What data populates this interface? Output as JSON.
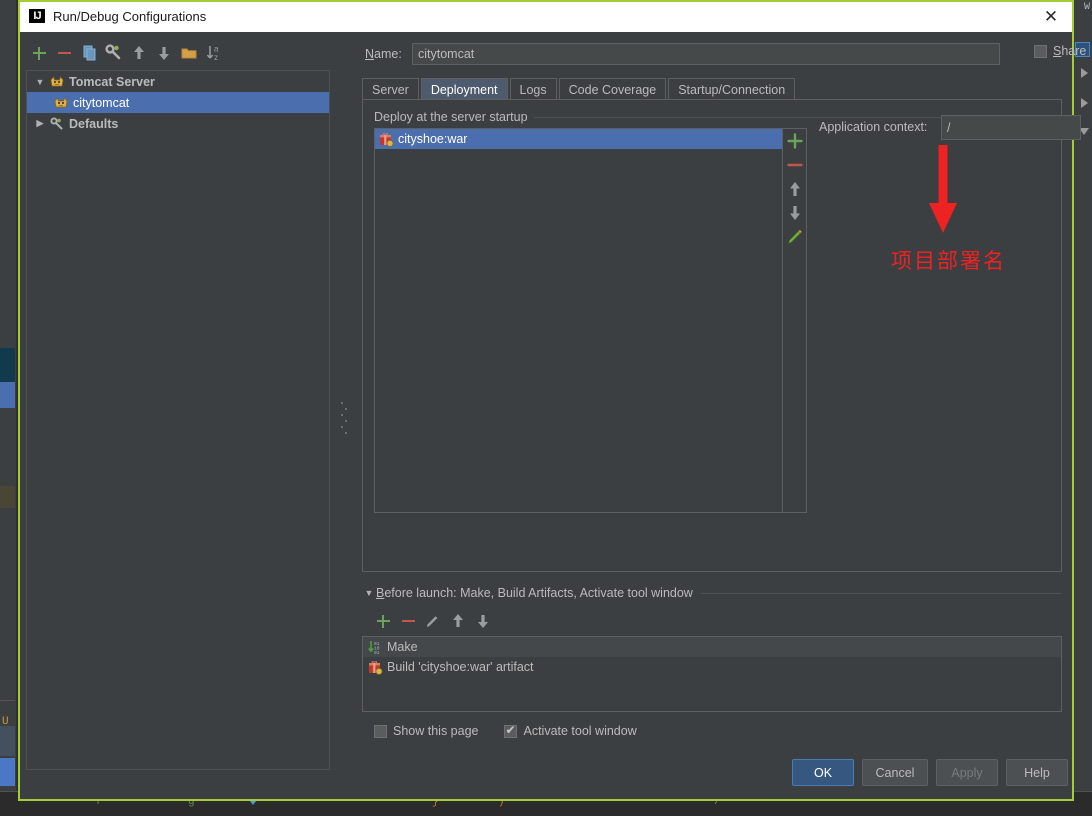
{
  "window": {
    "title": "Run/Debug Configurations",
    "logo_text": "IJ",
    "close_label": "✕"
  },
  "left_toolbar": {
    "buttons": [
      {
        "name": "add-configuration-button",
        "glyph": "+"
      },
      {
        "name": "remove-configuration-button",
        "glyph": "−"
      },
      {
        "name": "copy-configuration-button",
        "glyph": "copy"
      },
      {
        "name": "edit-defaults-button",
        "glyph": "wrench"
      },
      {
        "name": "move-up-button",
        "glyph": "↑"
      },
      {
        "name": "move-down-button",
        "glyph": "↓"
      },
      {
        "name": "create-folder-button",
        "glyph": "folder"
      },
      {
        "name": "sort-configurations-button",
        "glyph": "↓az"
      }
    ]
  },
  "tree": {
    "nodes": [
      {
        "label": "Tomcat Server",
        "twisty": "▼",
        "icon": "tomcat-icon",
        "bold": true,
        "selected": false,
        "indent": 0
      },
      {
        "label": "citytomcat",
        "twisty": "",
        "icon": "tomcat-icon",
        "bold": false,
        "selected": true,
        "indent": 1
      },
      {
        "label": "Defaults",
        "twisty": "▶",
        "icon": "wrench-icon",
        "bold": true,
        "selected": false,
        "indent": 0
      }
    ]
  },
  "form": {
    "name_label_prefix": "N",
    "name_label_rest": "ame:",
    "name_value": "citytomcat",
    "name_placeholder": "",
    "share_label_prefix": "S",
    "share_label_rest": "hare",
    "share_checked": false
  },
  "tabs": [
    {
      "label": "Server",
      "active": false
    },
    {
      "label": "Deployment",
      "active": true
    },
    {
      "label": "Logs",
      "active": false
    },
    {
      "label": "Code Coverage",
      "active": false
    },
    {
      "label": "Startup/Connection",
      "active": false
    }
  ],
  "deployment": {
    "group_title": "Deploy at the server startup",
    "items": [
      {
        "label": "cityshoe:war",
        "icon": "artifact-icon",
        "selected": true
      }
    ],
    "toolbar": [
      {
        "name": "add-artifact-button",
        "glyph": "+"
      },
      {
        "name": "remove-artifact-button",
        "glyph": "−"
      },
      {
        "name": "move-artifact-up-button",
        "glyph": "↑"
      },
      {
        "name": "move-artifact-down-button",
        "glyph": "↓"
      },
      {
        "name": "edit-artifact-button",
        "glyph": "pencil"
      }
    ],
    "context_label": "Application context:",
    "context_value": "/",
    "context_placeholder": ""
  },
  "annotation": {
    "text": "项目部署名",
    "color": "#ee2222",
    "arrow": "down-arrow"
  },
  "before_launch": {
    "twisty": "▼",
    "header_prefix": "B",
    "header_rest": "efore launch: Make, Build Artifacts, Activate tool window",
    "toolbar": [
      {
        "name": "add-task-button",
        "glyph": "+"
      },
      {
        "name": "remove-task-button",
        "glyph": "−"
      },
      {
        "name": "edit-task-button",
        "glyph": "pencil"
      },
      {
        "name": "move-task-up-button",
        "glyph": "↑"
      },
      {
        "name": "move-task-down-button",
        "glyph": "↓"
      }
    ],
    "tasks": [
      {
        "label": "Make",
        "icon": "make-icon",
        "highlight": true
      },
      {
        "label": "Build 'cityshoe:war' artifact",
        "icon": "artifact-icon",
        "highlight": false
      }
    ],
    "show_page_label": "Show this page",
    "show_page_checked": false,
    "activate_tool_window_label": "Activate tool window",
    "activate_tool_window_checked": true
  },
  "footer": {
    "ok_label": "OK",
    "cancel_label": "Cancel",
    "apply_label": "Apply",
    "help_label": "Help",
    "apply_enabled": false
  },
  "colors": {
    "accent_blue": "#4b6eaf",
    "default_button": "#365880",
    "dialog_border": "#a4cc34",
    "annotation_red": "#ee2222",
    "panel_bg": "#3c3f41"
  }
}
